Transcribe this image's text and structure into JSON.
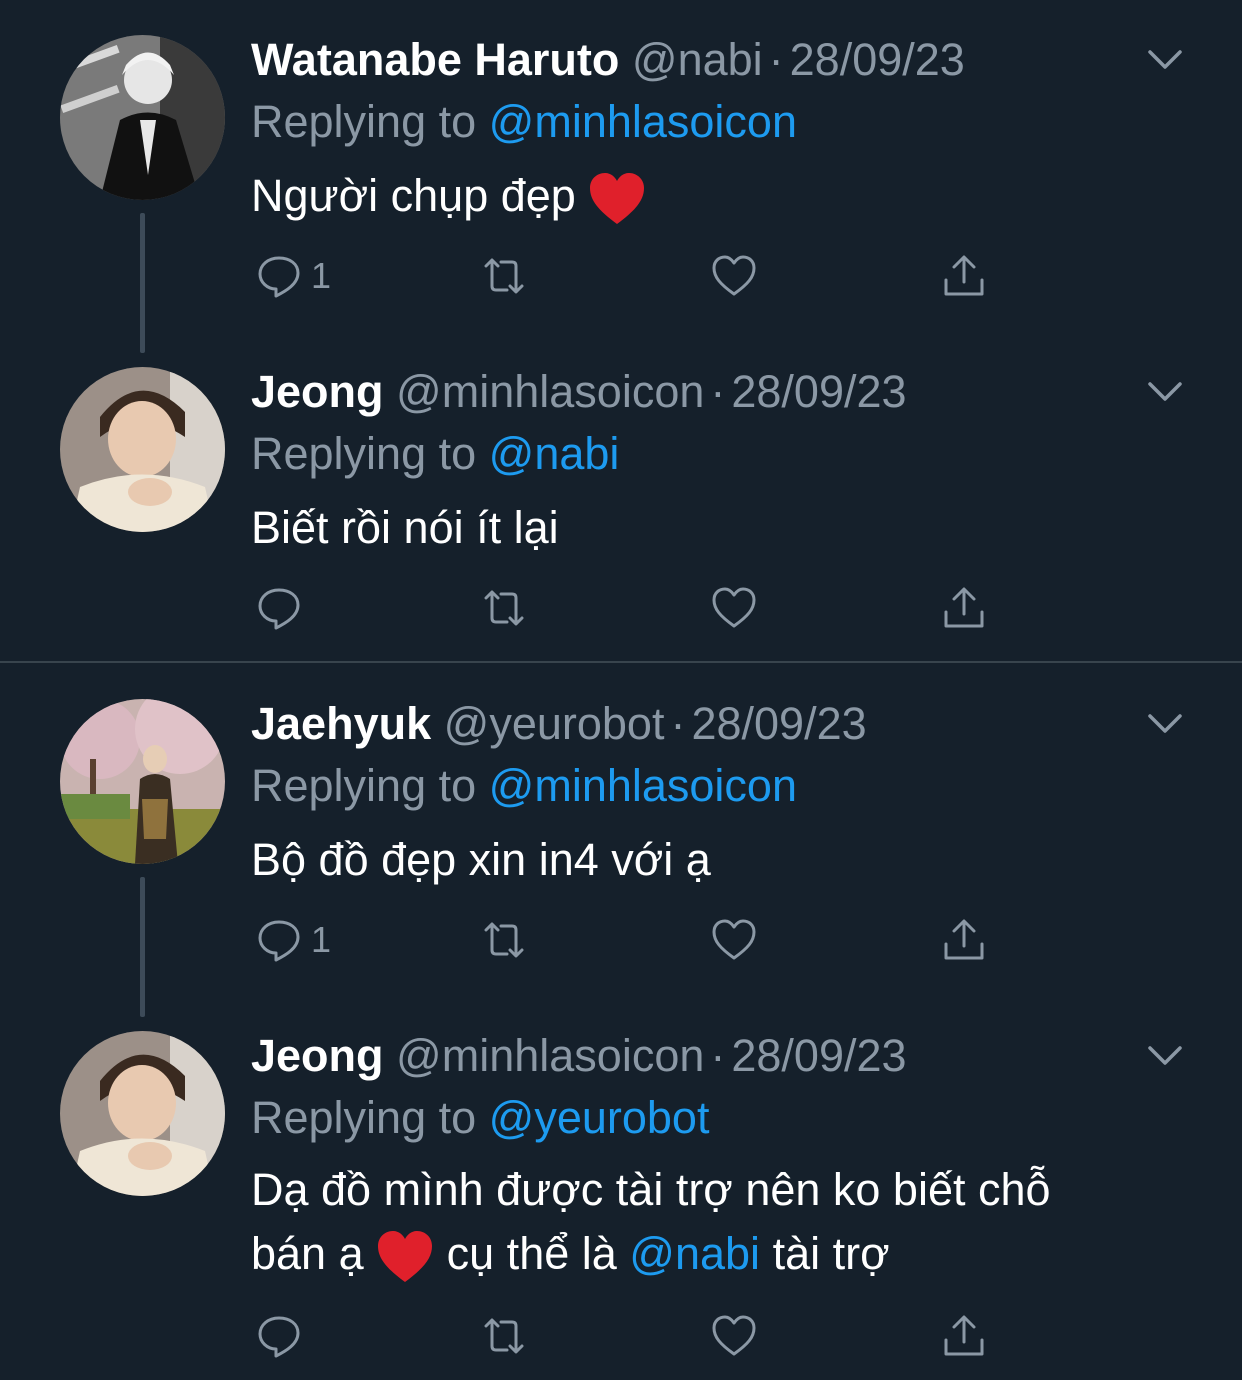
{
  "colors": {
    "background": "#15202b",
    "link": "#1d9bf0",
    "secondary_text": "#8b98a5",
    "thread_line": "#3d4b59",
    "heart": "#e0202b"
  },
  "tweets": [
    {
      "name": "Watanabe Haruto",
      "handle": "@nabi",
      "dot": "·",
      "date": "28/09/23",
      "replying_prefix": "Replying to",
      "replying_to": "@minhlasoicon",
      "text": "Người chụp đẹp",
      "emoji": "heart",
      "reply_count": "1"
    },
    {
      "name": "Jeong",
      "handle": "@minhlasoicon",
      "dot": "·",
      "date": "28/09/23",
      "replying_prefix": "Replying to",
      "replying_to": "@nabi",
      "text": "Biết rồi nói ít lại",
      "reply_count": ""
    },
    {
      "name": "Jaehyuk",
      "handle": "@yeurobot",
      "dot": "·",
      "date": "28/09/23",
      "replying_prefix": "Replying to",
      "replying_to": "@minhlasoicon",
      "text": "Bộ đồ đẹp xin in4 với ạ",
      "reply_count": "1"
    },
    {
      "name": "Jeong",
      "handle": "@minhlasoicon",
      "dot": "·",
      "date": "28/09/23",
      "replying_prefix": "Replying to",
      "replying_to": "@yeurobot",
      "text_line1": "Dạ đồ mình được tài trợ nên ko biết chỗ",
      "text_line2a": "bán ạ",
      "text_line2b": "cụ thể là",
      "text_mention": "@nabi",
      "text_line2c": "tài trợ",
      "reply_count": ""
    }
  ]
}
